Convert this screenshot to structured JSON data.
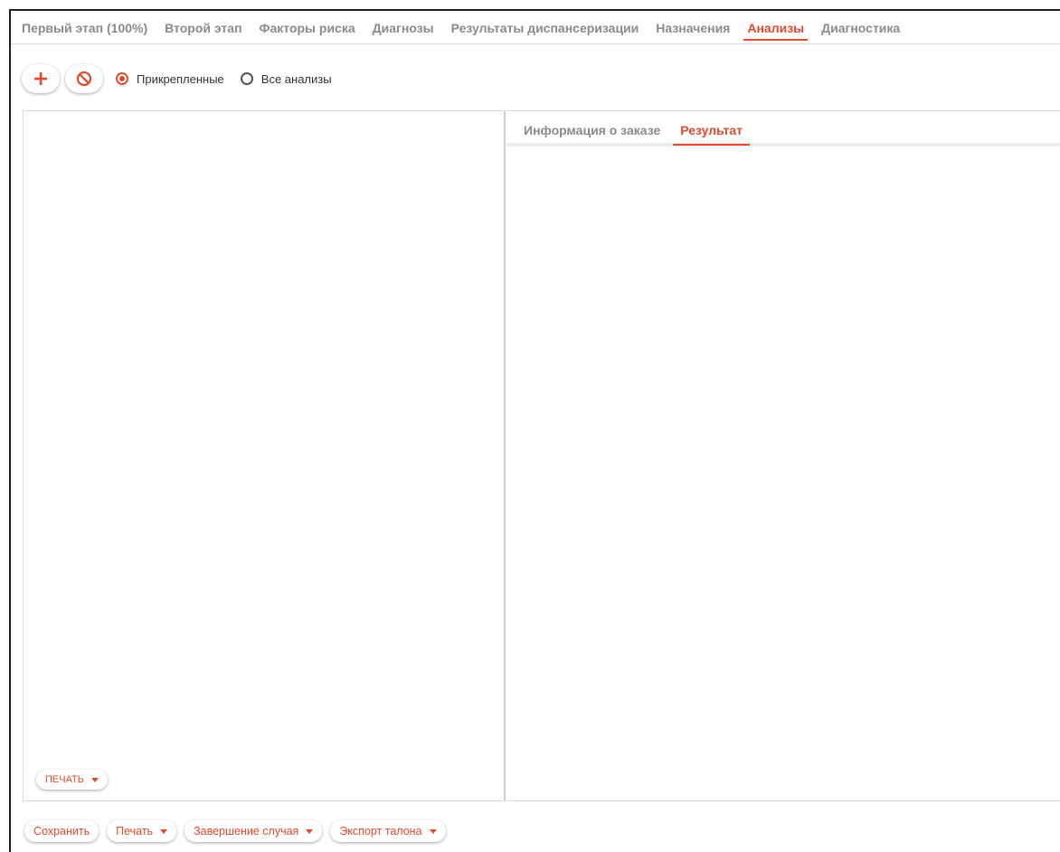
{
  "tabs": [
    {
      "label": "Первый этап (100%)",
      "active": false
    },
    {
      "label": "Второй этап",
      "active": false
    },
    {
      "label": "Факторы риска",
      "active": false
    },
    {
      "label": "Диагнозы",
      "active": false
    },
    {
      "label": "Результаты диспансеризации",
      "active": false
    },
    {
      "label": "Назначения",
      "active": false
    },
    {
      "label": "Анализы",
      "active": true
    },
    {
      "label": "Диагностика",
      "active": false
    }
  ],
  "toolbar": {
    "add_icon": "plus-icon",
    "cancel_icon": "block-icon",
    "radio_attached": "Прикрепленные",
    "radio_all": "Все анализы",
    "selected_filter": "Прикрепленные"
  },
  "right_panel": {
    "tabs": [
      {
        "label": "Информация о заказе",
        "active": false
      },
      {
        "label": "Результат",
        "active": true
      }
    ]
  },
  "left_panel": {
    "print_label": "ПЕЧАТЬ"
  },
  "footer": {
    "save": "Сохранить",
    "print": "Печать",
    "finish_case": "Завершение случая",
    "export_ticket": "Экспорт талона"
  },
  "colors": {
    "accent": "#e04a2c",
    "tab_inactive": "#8a8a8a"
  }
}
